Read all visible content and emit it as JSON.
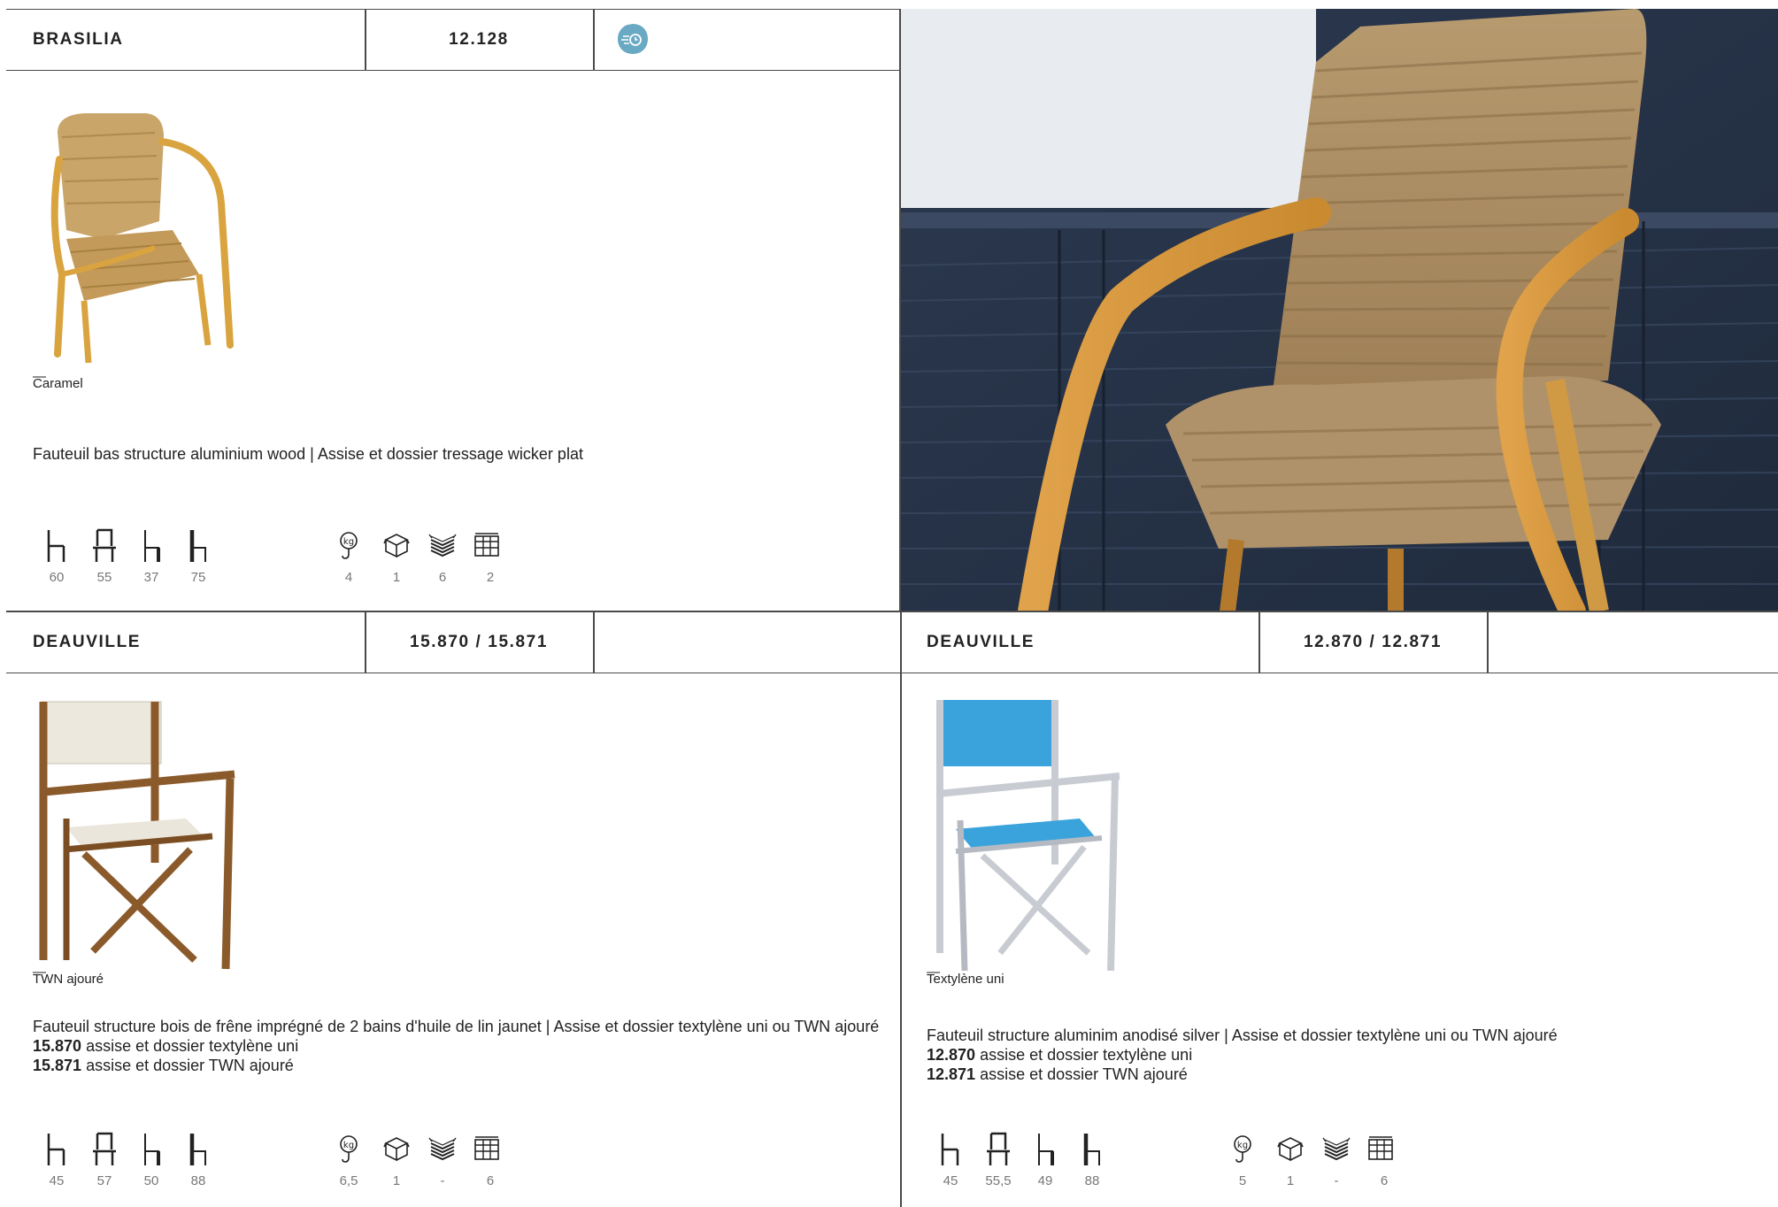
{
  "products": [
    {
      "name": "BRASILIA",
      "ref": "12.128",
      "badge_icon": "fast-delivery-icon",
      "finish": "Caramel",
      "description": "Fauteuil bas structure aluminium wood | Assise et dossier tressage wicker plat",
      "variants": [],
      "dimensions": [
        "60",
        "55",
        "37",
        "75"
      ],
      "logistics": [
        "4",
        "1",
        "6",
        "2"
      ]
    },
    {
      "name": "DEAUVILLE",
      "ref": "15.870 / 15.871",
      "finish": "TWN ajouré",
      "description": "Fauteuil structure bois de frêne imprégné de 2 bains d'huile de lin jaunet | Assise et dossier textylène uni ou TWN ajouré",
      "variants": [
        {
          "code": "15.870",
          "text": " assise et dossier textylène uni"
        },
        {
          "code": "15.871",
          "text": " assise et dossier TWN ajouré"
        }
      ],
      "dimensions": [
        "45",
        "57",
        "50",
        "88"
      ],
      "logistics": [
        "6,5",
        "1",
        "-",
        "6"
      ]
    },
    {
      "name": "DEAUVILLE",
      "ref": "12.870 / 12.871",
      "finish": "Textylène uni",
      "description": "Fauteuil structure aluminim anodisé silver | Assise et dossier textylène uni ou TWN ajouré",
      "variants": [
        {
          "code": "12.870",
          "text": " assise et dossier textylène uni"
        },
        {
          "code": "12.871",
          "text": " assise et dossier TWN ajouré"
        }
      ],
      "dimensions": [
        "45",
        "55,5",
        "49",
        "88"
      ],
      "logistics": [
        "5",
        "1",
        "-",
        "6"
      ]
    }
  ],
  "dash": "—",
  "icons": {
    "dimensions": [
      "seat-height-icon",
      "seat-depth-icon",
      "armrest-height-icon",
      "total-height-icon"
    ],
    "logistics": [
      "weight-icon",
      "box-icon",
      "stack-icon",
      "pallet-icon"
    ]
  },
  "colors": {
    "border": "#4a4a4a",
    "badge": "#6aa9c4",
    "values": "#777777",
    "seat_blue": "#3aa3dc"
  }
}
